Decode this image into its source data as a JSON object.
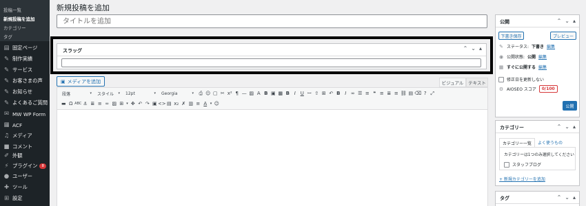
{
  "sidebar": {
    "submenu": [
      {
        "label": "投稿一覧",
        "active": false
      },
      {
        "label": "新規投稿を追加",
        "active": true
      },
      {
        "label": "カテゴリー",
        "active": false
      },
      {
        "label": "タグ",
        "active": false
      }
    ],
    "menu": [
      {
        "label": "固定ページ",
        "icon": "page-icon"
      },
      {
        "label": "制作実績",
        "icon": "pin-icon"
      },
      {
        "label": "サービス",
        "icon": "pin-icon"
      },
      {
        "label": "お客さまの声",
        "icon": "pin-icon"
      },
      {
        "label": "お知らせ",
        "icon": "pin-icon"
      },
      {
        "label": "よくあるご質問",
        "icon": "pin-icon"
      },
      {
        "label": "MW WP Form",
        "icon": "form-icon"
      },
      {
        "label": "ACF",
        "icon": "acf-icon"
      },
      {
        "label": "メディア",
        "icon": "media-icon"
      },
      {
        "label": "コメント",
        "icon": "comment-icon"
      },
      {
        "label": "外観",
        "icon": "brush-icon"
      },
      {
        "label": "プラグイン",
        "icon": "plugin-icon",
        "badge": "8"
      },
      {
        "label": "ユーザー",
        "icon": "user-icon"
      },
      {
        "label": "ツール",
        "icon": "wrench-icon"
      },
      {
        "label": "設定",
        "icon": "settings-icon"
      }
    ]
  },
  "main": {
    "page_title": "新規投稿を追加",
    "title_placeholder": "タイトルを追加",
    "slug_box": {
      "title": "スラッグ",
      "value": ""
    },
    "media_button": "メディアを追加",
    "tabs": {
      "visual": "ビジュアル",
      "text": "テキスト"
    },
    "toolbar": {
      "paragraph_select": "段落",
      "style_select": "スタイル",
      "size_select": "12pt",
      "font_select": "Georgia"
    }
  },
  "publish": {
    "title": "公開",
    "save_draft": "下書き保存",
    "preview": "プレビュー",
    "status_label": "ステータス:",
    "status_value": "下書き",
    "status_edit": "編集",
    "visibility_label": "公開状態:",
    "visibility_value": "公開",
    "visibility_edit": "編集",
    "schedule_label": "すぐに公開する",
    "schedule_edit": "編集",
    "no_update_label": "修正日を更新しない",
    "aioseo_label": "AIOSEO スコア",
    "aioseo_score": "0/100",
    "publish_button": "公開"
  },
  "categories": {
    "title": "カテゴリー",
    "tab_all": "カテゴリー一覧",
    "tab_popular": "よく使うもの",
    "note": "カテゴリーは1つのみ選択してください",
    "items": [
      "スタッフブログ"
    ],
    "add_link": "+ 新規カテゴリーを追加"
  },
  "tags": {
    "title": "タグ"
  },
  "colors": {
    "accent": "#2271b1",
    "sidebar": "#1d2327",
    "danger": "#d63638"
  }
}
